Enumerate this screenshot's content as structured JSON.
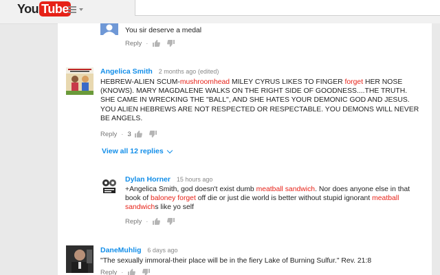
{
  "header": {
    "logo_you": "You",
    "logo_tube": "Tube"
  },
  "comments": [
    {
      "text": "You sir deserve a medal",
      "reply_label": "Reply",
      "separator": "·"
    },
    {
      "author": "Angelica Smith",
      "meta": "2 months ago (edited)",
      "text_parts": [
        "HEBREW-ALIEN SCUM-",
        "mushroomhead",
        " MILEY CYRUS LIKES TO FINGER ",
        "forget",
        " HER NOSE (KNOWS). MARY MAGDALENE WALKS ON THE RIGHT SIDE OF GOODNESS....THE TRUTH. SHE CAME IN WRECKING THE \"BALL\", AND SHE HATES YOUR DEMONIC GOD AND JESUS. YOU ALIEN HEBREWS ARE NOT RESPECTED OR RESPECTABLE. YOU DEMONS WILL NEVER BE ANGELS."
      ],
      "reply_label": "Reply",
      "separator": "·",
      "like_count": "3",
      "view_replies": "View all 12 replies"
    },
    {
      "author": "Dylan Horner",
      "meta": "15 hours ago",
      "text_parts": [
        "+Angelica Smith, god doesn't exist dumb ",
        "meatball sandwich",
        ". Nor does anyone else in that book of ",
        "baloney",
        " ",
        "forget",
        " off die or just die world is better without stupid ignorant ",
        "meatball sandwich",
        "s like yo self"
      ],
      "reply_label": "Reply",
      "separator": "·"
    },
    {
      "author": "DaneMuhlig",
      "meta": "6 days ago",
      "text": "\"The sexually immoral-their place will be in the fiery Lake of Burning Sulfur.\" Rev. 21:8",
      "reply_label": "Reply",
      "separator": "·"
    }
  ],
  "colors": {
    "accent": "#128ee9",
    "highlight": "#e62117",
    "brand_red": "#e62117"
  }
}
